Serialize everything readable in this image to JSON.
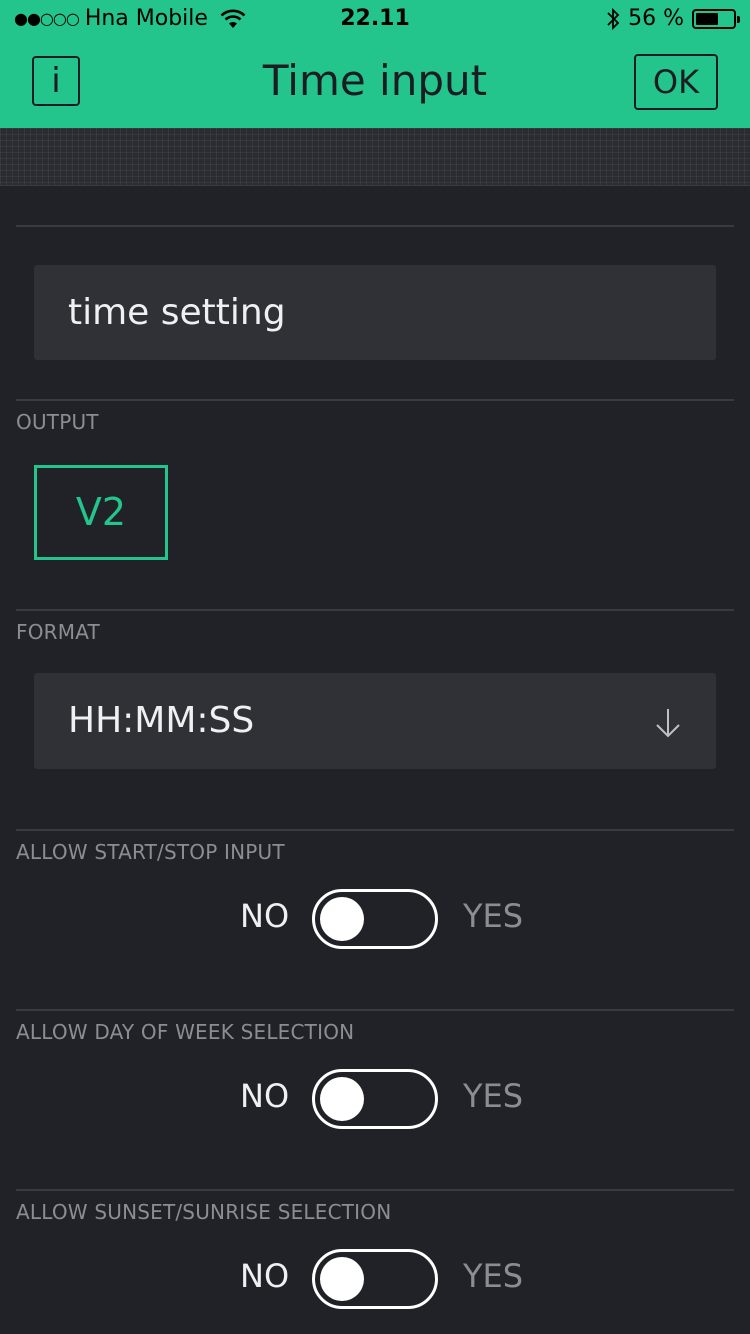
{
  "status_bar": {
    "signal": "●●○○○",
    "carrier": "Hna Mobile",
    "time": "22.11",
    "battery_percent": "56 %",
    "battery_level": 0.56,
    "icons": [
      "wifi-icon",
      "bluetooth-icon",
      "battery-icon"
    ]
  },
  "header": {
    "info_label": "i",
    "title": "Time input",
    "ok_label": "OK",
    "background_color": "#24c48d"
  },
  "name_field": {
    "value": "time setting"
  },
  "output": {
    "label": "OUTPUT",
    "pin": "V2",
    "accent_color": "#24c48d"
  },
  "format": {
    "label": "FORMAT",
    "selected": "HH:MM:SS",
    "icon": "arrow-down-icon"
  },
  "toggles": [
    {
      "label": "ALLOW START/STOP INPUT",
      "off_label": "NO",
      "on_label": "YES",
      "value": false
    },
    {
      "label": "ALLOW DAY OF WEEK SELECTION",
      "off_label": "NO",
      "on_label": "YES",
      "value": false
    },
    {
      "label": "ALLOW SUNSET/SUNRISE SELECTION",
      "off_label": "NO",
      "on_label": "YES",
      "value": false
    }
  ]
}
